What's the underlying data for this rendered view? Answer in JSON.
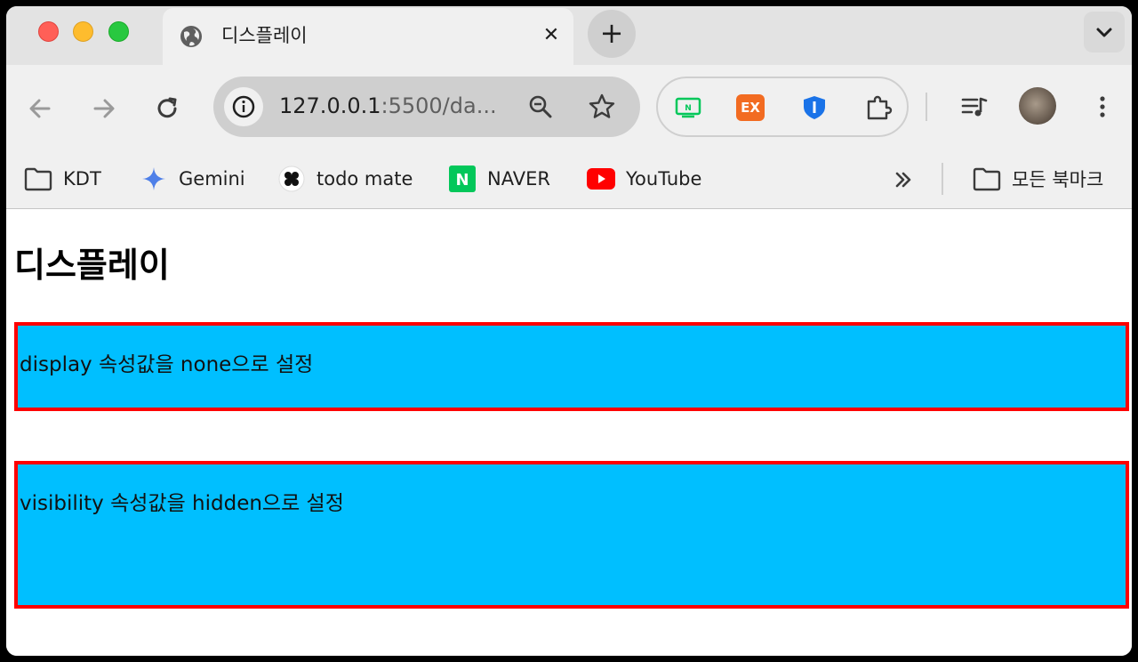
{
  "browser": {
    "tab": {
      "title": "디스플레이",
      "favicon": "globe-icon",
      "close_glyph": "✕"
    },
    "newtab_glyph": "+",
    "address": {
      "host": "127.0.0.1",
      "rest": ":5500/da..."
    },
    "bookmarks": [
      {
        "label": "KDT",
        "icon": "folder-icon"
      },
      {
        "label": "Gemini",
        "icon": "gemini-icon"
      },
      {
        "label": "todo mate",
        "icon": "todomate-icon"
      },
      {
        "label": "NAVER",
        "icon": "naver-icon"
      },
      {
        "label": "YouTube",
        "icon": "youtube-icon"
      }
    ],
    "all_bookmarks": "모든 북마크",
    "extensions": [
      "naver-ext-icon",
      "ex-ext-icon",
      "shield-ext-icon",
      "puzzle-icon"
    ],
    "ex_label": "EX",
    "naver_ext_letter": "N",
    "naver_bm_letter": "N"
  },
  "page": {
    "heading": "디스플레이",
    "box1_text": "display 속성값을 none으로 설정",
    "box2_text": "visibility 속성값을 hidden으로 설정"
  },
  "colors": {
    "box_background": "#00bfff",
    "box_border": "#ff0000"
  }
}
